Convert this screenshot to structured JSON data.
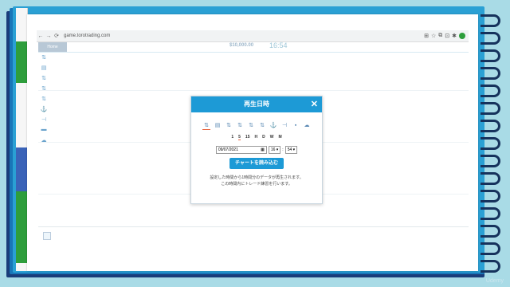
{
  "browser": {
    "back": "←",
    "forward": "→",
    "reload": "⟳",
    "url": "game.torotrading.com",
    "tools": [
      "⊞",
      "☆",
      "⧉",
      "⊡"
    ],
    "extensions": [
      "✱"
    ]
  },
  "app": {
    "tab_label": "Home",
    "balance": "$10,000.00",
    "clock": "16:54"
  },
  "side_tools": [
    "⇅",
    "▤",
    "⇅",
    "⇅",
    "⇅",
    "⚓",
    "⊣",
    "▬",
    "☁"
  ],
  "modal": {
    "title": "再生日時",
    "close": "✕",
    "tools": [
      "⇅",
      "▤",
      "⇅",
      "⇅",
      "⇅",
      "⇅",
      "⚓",
      "⊣",
      "▪",
      "☁"
    ],
    "active_tool_index": 0,
    "timeframes": [
      "1",
      "5",
      "15",
      "H",
      "D",
      "W",
      "M"
    ],
    "active_timeframe_index": 1,
    "date_value": "09/07/2021",
    "date_icon": "▦",
    "hour_value": "16 ▾",
    "separator": ":",
    "minute_value": "54 ▾",
    "load_button": "チャートを読み込む",
    "description_line1": "設定した時間から1時間分のデータが再生されます。",
    "description_line2": "この時間内にトレード練習を行います。"
  },
  "watermark": "Udemy",
  "colors": {
    "accent": "#1d9ad6",
    "active_underline": "#e8623d",
    "background": "#a9dbe6"
  }
}
